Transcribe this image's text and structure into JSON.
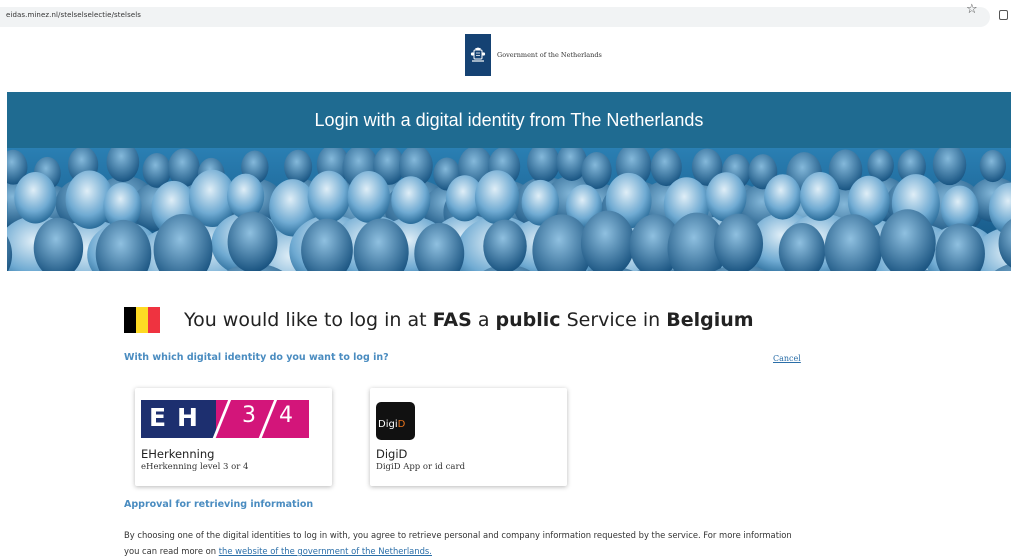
{
  "browser": {
    "url": "eidas.minez.nl/stelselselectie/stelsels",
    "bookmark_icon": "star-icon",
    "extension_icon": "puzzle-icon"
  },
  "header": {
    "logo_text": "Government of the Netherlands"
  },
  "banner": {
    "title": "Login with a digital identity from The Netherlands"
  },
  "heading": {
    "part1": "You would like to log in at ",
    "org": "FAS",
    "part2": " a ",
    "kind": "public",
    "part3": " Service in ",
    "country": "Belgium",
    "flag_colors": [
      "#000000",
      "#fdda24",
      "#ef3340"
    ]
  },
  "question": "With which digital identity do you want to log in?",
  "cancel": "Cancel",
  "options": [
    {
      "name": "EHerkenning",
      "subtitle": "eHerkenning level 3 or 4",
      "logo_letters": [
        "E",
        "H"
      ],
      "logo_levels": [
        "3",
        "4"
      ],
      "colors": {
        "left": "#1d2f6f",
        "right": "#d3157a"
      }
    },
    {
      "name": "DigiD",
      "subtitle": "DigiD App or id card",
      "logo_text_main": "Digi",
      "logo_text_accent": "D"
    }
  ],
  "approval": {
    "title": "Approval for retrieving information",
    "text": "By choosing one of the digital identities to log in with, you agree to retrieve personal and company information requested by the service. For more information you can read more on ",
    "link": "the website of the government of the Netherlands."
  }
}
